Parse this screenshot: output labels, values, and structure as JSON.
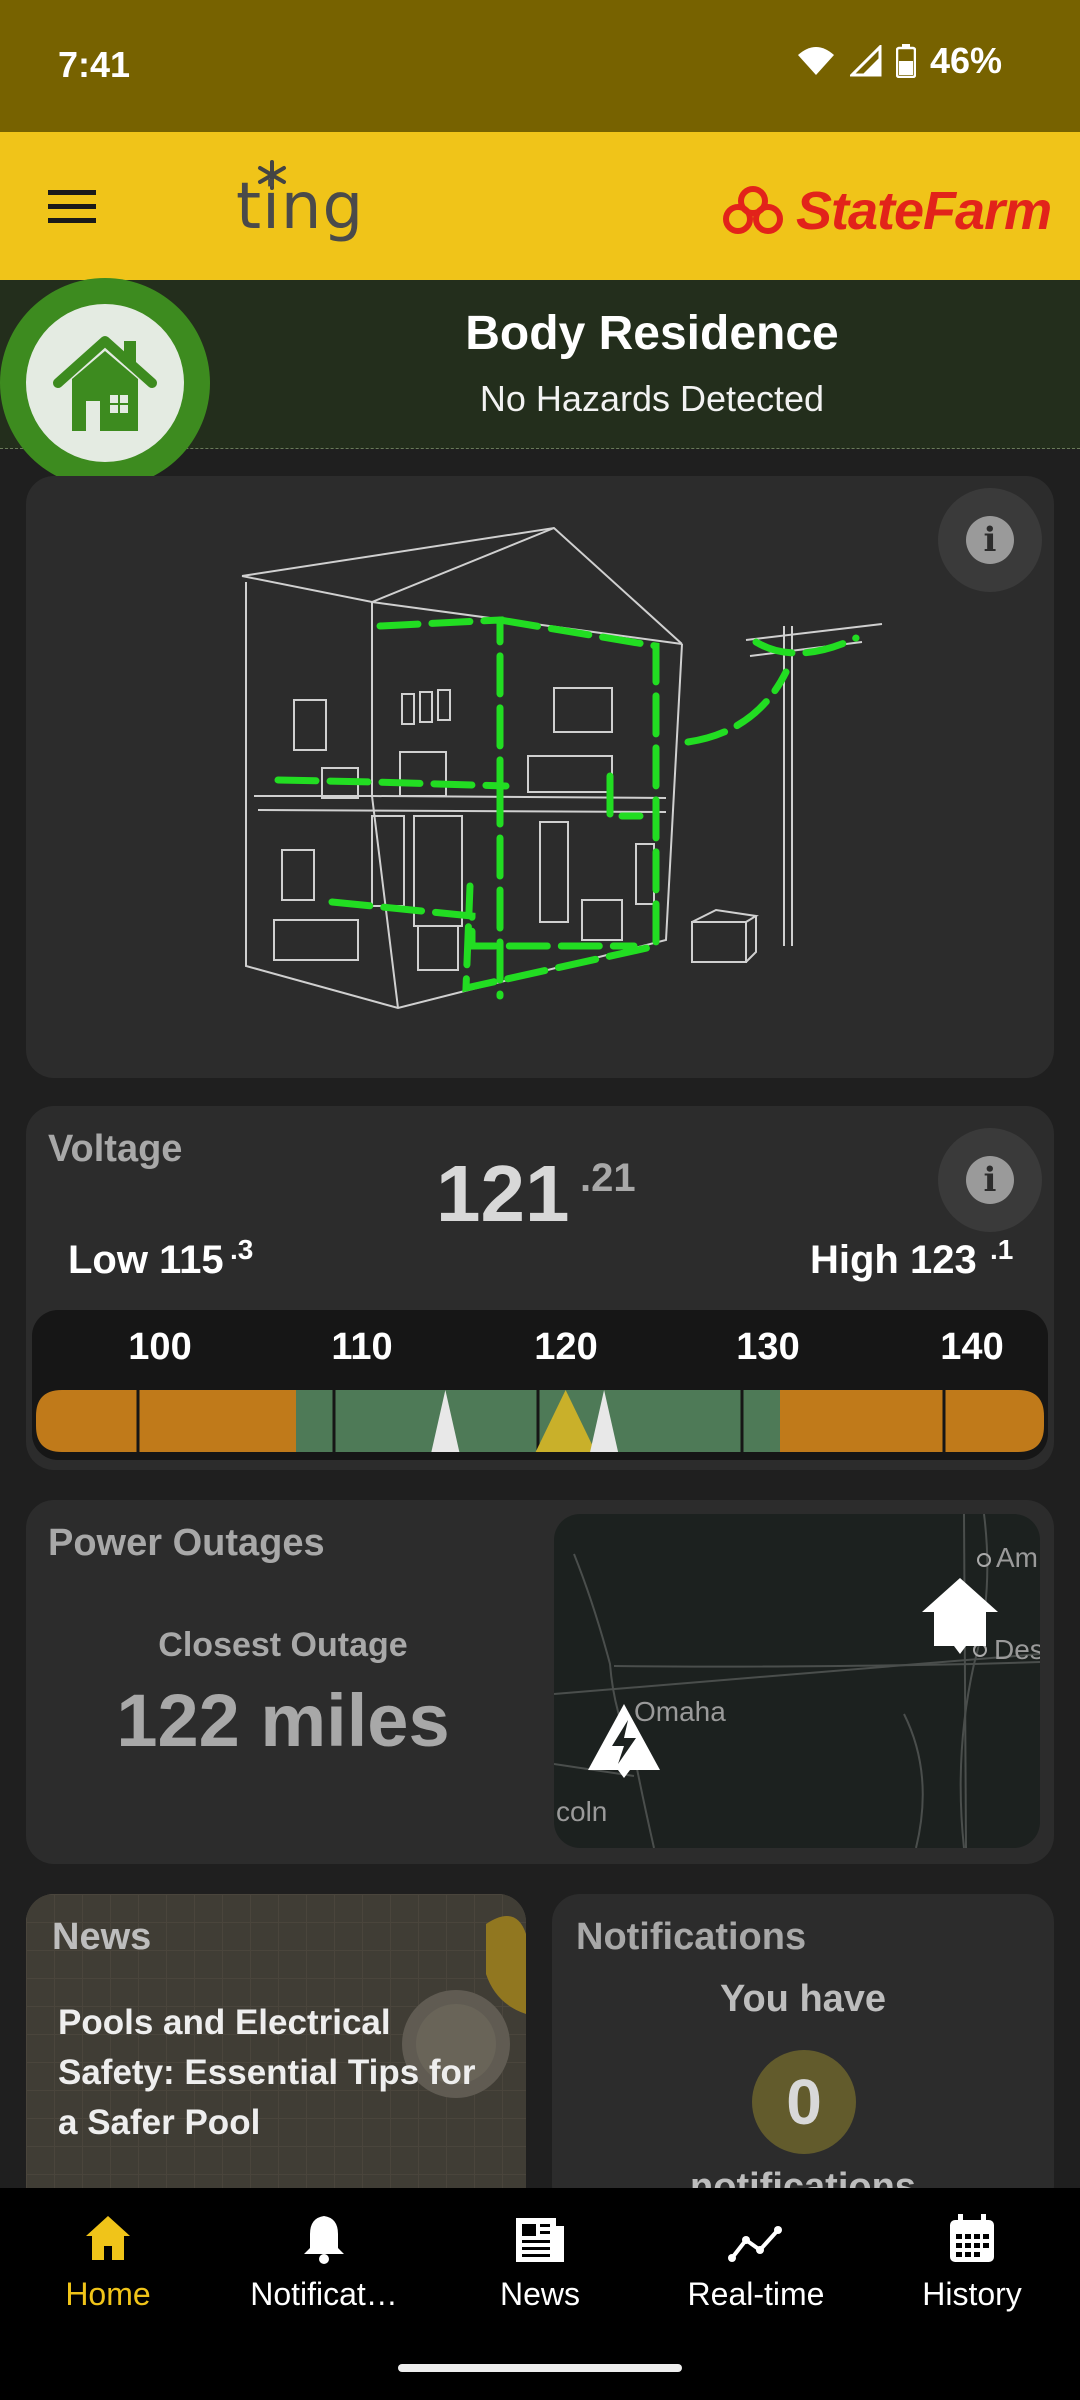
{
  "status_bar": {
    "time": "7:41",
    "battery": "46%"
  },
  "app_bar": {
    "left_logo_text": "ting",
    "right_logo_text": "StateFarm"
  },
  "residence": {
    "title": "Body Residence",
    "subtitle": "No Hazards Detected"
  },
  "voltage": {
    "label": "Voltage",
    "value_int": "121",
    "value_dec": ".21",
    "low_label": "Low 115",
    "low_dec": ".3",
    "high_label": "High 123",
    "high_dec": ".1",
    "ticks": [
      "100",
      "110",
      "120",
      "130",
      "140"
    ],
    "current": 121.21,
    "low": 115.3,
    "high": 123.1
  },
  "outages": {
    "label": "Power Outages",
    "sub": "Closest Outage",
    "value": "122 miles",
    "map_labels": [
      "Omaha",
      "coln",
      "Am",
      "Des"
    ]
  },
  "news": {
    "label": "News",
    "headline": "Pools and Electrical Safety: Essential Tips for a Safer Pool"
  },
  "notifications": {
    "label": "Notifications",
    "sub": "You have",
    "count": "0",
    "cut_text": "notifications"
  },
  "bottom_nav": [
    {
      "label": "Home",
      "icon": "home-icon",
      "active": true
    },
    {
      "label": "Notificat…",
      "icon": "bell-icon",
      "active": false
    },
    {
      "label": "News",
      "icon": "newspaper-icon",
      "active": false
    },
    {
      "label": "Real-time",
      "icon": "trend-icon",
      "active": false
    },
    {
      "label": "History",
      "icon": "calendar-icon",
      "active": false
    }
  ],
  "colors": {
    "accent": "#f0c419",
    "status": "#776200",
    "green": "#3d8b1f",
    "wire": "#22dd22",
    "brand_red": "#e2231a"
  }
}
